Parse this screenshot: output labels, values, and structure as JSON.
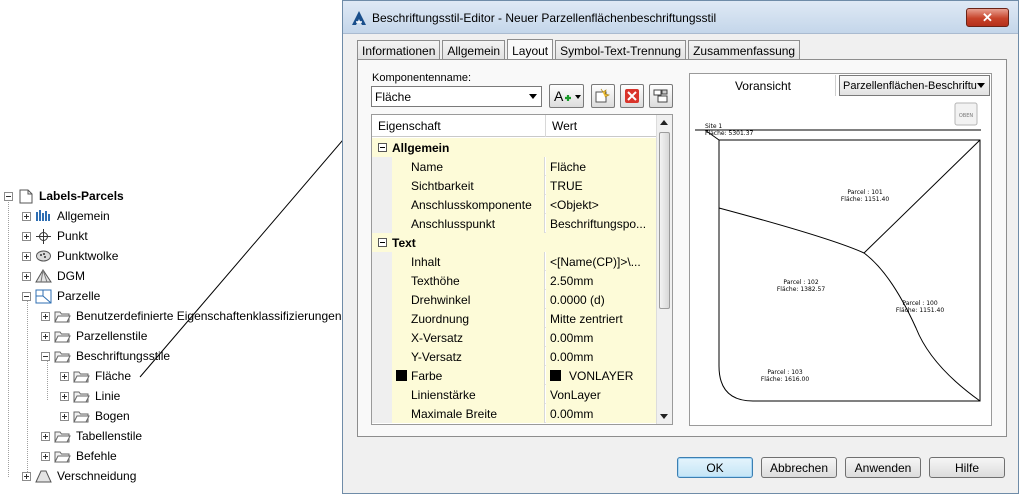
{
  "tree": {
    "root_label": "Labels-Parcels",
    "items": [
      {
        "label": "Allgemein"
      },
      {
        "label": "Punkt"
      },
      {
        "label": "Punktwolke"
      },
      {
        "label": "DGM"
      },
      {
        "label": "Parzelle"
      },
      {
        "label": "Benutzerdefinierte Eigenschaftenklassifizierungen"
      },
      {
        "label": "Parzellenstile"
      },
      {
        "label": "Beschriftungsstile"
      },
      {
        "label": "Fläche"
      },
      {
        "label": "Linie"
      },
      {
        "label": "Bogen"
      },
      {
        "label": "Tabellenstile"
      },
      {
        "label": "Befehle"
      },
      {
        "label": "Verschneidung"
      }
    ]
  },
  "dialog": {
    "title": "Beschriftungsstil-Editor - Neuer Parzellenflächenbeschriftungsstil",
    "close_symbol": "✕",
    "tabs": [
      {
        "label": "Informationen"
      },
      {
        "label": "Allgemein"
      },
      {
        "label": "Layout"
      },
      {
        "label": "Symbol-Text-Trennung"
      },
      {
        "label": "Zusammenfassung"
      }
    ],
    "active_tab": "Layout",
    "component": {
      "label": "Komponentenname:",
      "value": "Fläche"
    },
    "grid": {
      "col_property": "Eigenschaft",
      "col_value": "Wert",
      "rows": [
        {
          "type": "cat",
          "name": "Allgemein"
        },
        {
          "type": "prop",
          "name": "Name",
          "value": "Fläche"
        },
        {
          "type": "prop",
          "name": "Sichtbarkeit",
          "value": "TRUE"
        },
        {
          "type": "prop",
          "name": "Anschlusskomponente",
          "value": "<Objekt>"
        },
        {
          "type": "prop",
          "name": "Anschlusspunkt",
          "value": "Beschriftungspo..."
        },
        {
          "type": "cat",
          "name": "Text"
        },
        {
          "type": "prop",
          "name": "Inhalt",
          "value": "<[Name(CP)]>\\..."
        },
        {
          "type": "prop",
          "name": "Texthöhe",
          "value": "2.50mm"
        },
        {
          "type": "prop",
          "name": "Drehwinkel",
          "value": "0.0000 (d)"
        },
        {
          "type": "prop",
          "name": "Zuordnung",
          "value": "Mitte zentriert"
        },
        {
          "type": "prop",
          "name": "X-Versatz",
          "value": "0.00mm"
        },
        {
          "type": "prop",
          "name": "Y-Versatz",
          "value": "0.00mm"
        },
        {
          "type": "prop",
          "name": "Farbe",
          "value": "VONLAYER",
          "swatch": true
        },
        {
          "type": "prop",
          "name": "Linienstärke",
          "value": "VonLayer"
        },
        {
          "type": "prop",
          "name": "Maximale Breite",
          "value": "0.00mm"
        }
      ]
    },
    "preview": {
      "label": "Voransicht",
      "select_value": "Parzellenflächen-Beschriftu",
      "corner_badge": "OBEN",
      "site_label": "Site 1",
      "site_area": "Fläche: 5301.37",
      "parcels": [
        {
          "name": "Parcel : 101",
          "area": "Fläche: 1151.40"
        },
        {
          "name": "Parcel : 102",
          "area": "Fläche: 1382.57"
        },
        {
          "name": "Parcel : 100",
          "area": "Fläche: 1151.40"
        },
        {
          "name": "Parcel : 103",
          "area": "Fläche: 1616.00"
        }
      ]
    },
    "buttons": {
      "ok": "OK",
      "cancel": "Abbrechen",
      "apply": "Anwenden",
      "help": "Hilfe"
    }
  },
  "colors": {
    "accent": "#3c7fb1",
    "grid_cell": "#fdfbd8",
    "close_red": "#c7432a"
  }
}
